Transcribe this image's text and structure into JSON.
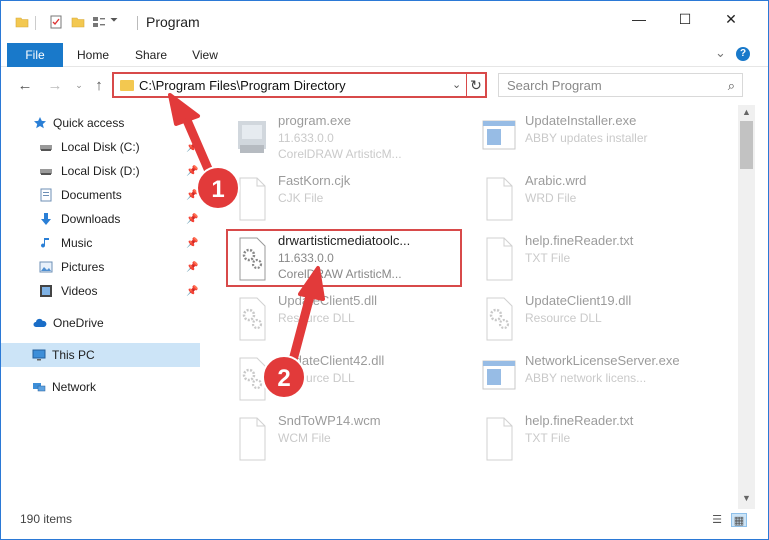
{
  "window": {
    "title": "Program",
    "minimize": "—",
    "maximize": "☐",
    "close": "✕"
  },
  "ribbon": {
    "tabs": [
      "File",
      "Home",
      "Share",
      "View"
    ],
    "expand": "⌄",
    "help": "?"
  },
  "address": {
    "path": "C:\\Program Files\\Program Directory",
    "dropdown": "⌄",
    "refresh": "↻"
  },
  "search": {
    "placeholder": "Search Program"
  },
  "nav": {
    "items": [
      {
        "label": "Quick access",
        "icon": "star-icon"
      },
      {
        "label": "Local Disk (C:)",
        "icon": "drive-icon"
      },
      {
        "label": "Local Disk (D:)",
        "icon": "drive-icon"
      },
      {
        "label": "Documents",
        "icon": "documents-icon"
      },
      {
        "label": "Downloads",
        "icon": "download-icon"
      },
      {
        "label": "Music",
        "icon": "music-icon"
      },
      {
        "label": "Pictures",
        "icon": "pictures-icon"
      },
      {
        "label": "Videos",
        "icon": "videos-icon"
      },
      {
        "label": "OneDrive",
        "icon": "cloud-icon"
      },
      {
        "label": "This PC",
        "icon": "computer-icon"
      },
      {
        "label": "Network",
        "icon": "network-icon"
      }
    ],
    "pin": "📌"
  },
  "files": [
    {
      "name": "program.exe",
      "line2": "11.633.0.0",
      "line3": "CorelDRAW ArtisticM..."
    },
    {
      "name": "UpdateInstaller.exe",
      "line2": "ABBY updates installer",
      "line3": ""
    },
    {
      "name": "FastKorn.cjk",
      "line2": "CJK File",
      "line3": ""
    },
    {
      "name": "Arabic.wrd",
      "line2": "WRD File",
      "line3": ""
    },
    {
      "name": "drwartisticmediatoolc...",
      "line2": "11.633.0.0",
      "line3": "CorelDRAW ArtisticM..."
    },
    {
      "name": "help.fineReader.txt",
      "line2": "TXT File",
      "line3": ""
    },
    {
      "name": "UpdateClient5.dll",
      "line2": "Resource DLL",
      "line3": ""
    },
    {
      "name": "UpdateClient19.dll",
      "line2": "Resource DLL",
      "line3": ""
    },
    {
      "name": "UpdateClient42.dll",
      "line2": "Resource DLL",
      "line3": ""
    },
    {
      "name": "NetworkLicenseServer.exe",
      "line2": "ABBY network licens...",
      "line3": ""
    },
    {
      "name": "SndToWP14.wcm",
      "line2": "WCM File",
      "line3": ""
    },
    {
      "name": "help.fineReader.txt",
      "line2": "TXT File",
      "line3": ""
    }
  ],
  "status": {
    "count": "190 items"
  },
  "annotations": {
    "step1": "1",
    "step2": "2",
    "badge_color": "#e23a3a",
    "box_color": "#d84a4a"
  }
}
